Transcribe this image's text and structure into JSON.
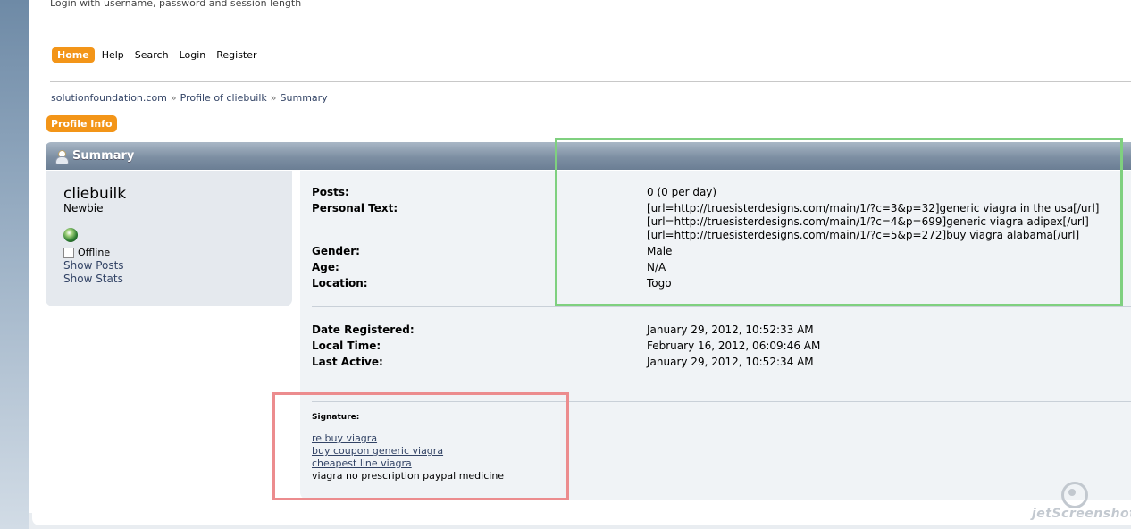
{
  "header": {
    "login_hint": "Login with username, password and session length"
  },
  "menu": [
    "Home",
    "Help",
    "Search",
    "Login",
    "Register"
  ],
  "breadcrumb": [
    "solutionfoundation.com",
    "Profile of cliebuilk",
    "Summary"
  ],
  "breadcrumb_sep": "»",
  "profile_info_button": "Profile Info",
  "section_title": "Summary",
  "user": {
    "name": "cliebuilk",
    "rank": "Newbie",
    "status": "Offline",
    "links": [
      "Show Posts",
      "Show Stats"
    ]
  },
  "details": {
    "posts_label": "Posts:",
    "posts_value": "0 (0 per day)",
    "personal_text_label": "Personal Text:",
    "personal_text_lines": [
      "[url=http://truesisterdesigns.com/main/1/?c=3&p=32]generic viagra in the usa[/url]",
      "[url=http://truesisterdesigns.com/main/1/?c=4&p=699]generic viagra adipex[/url]",
      "[url=http://truesisterdesigns.com/main/1/?c=5&p=272]buy viagra alabama[/url]"
    ],
    "gender_label": "Gender:",
    "gender_value": "Male",
    "age_label": "Age:",
    "age_value": "N/A",
    "location_label": "Location:",
    "location_value": "Togo",
    "registered_label": "Date Registered:",
    "registered_value": "January 29, 2012, 10:52:33 AM",
    "local_time_label": "Local Time:",
    "local_time_value": "February 16, 2012, 06:09:46 AM",
    "last_active_label": "Last Active:",
    "last_active_value": "January 29, 2012, 10:52:34 AM"
  },
  "signature": {
    "label": "Signature:",
    "links": [
      "re buy viagra",
      "buy coupon generic viagra",
      "cheapest line viagra"
    ],
    "text": "viagra no prescription paypal medicine"
  },
  "watermark": "jetScreenshot",
  "colors": {
    "accent_orange": "#f39518",
    "highlight_green": "#7fd07f",
    "highlight_red": "#ec8c8e"
  }
}
